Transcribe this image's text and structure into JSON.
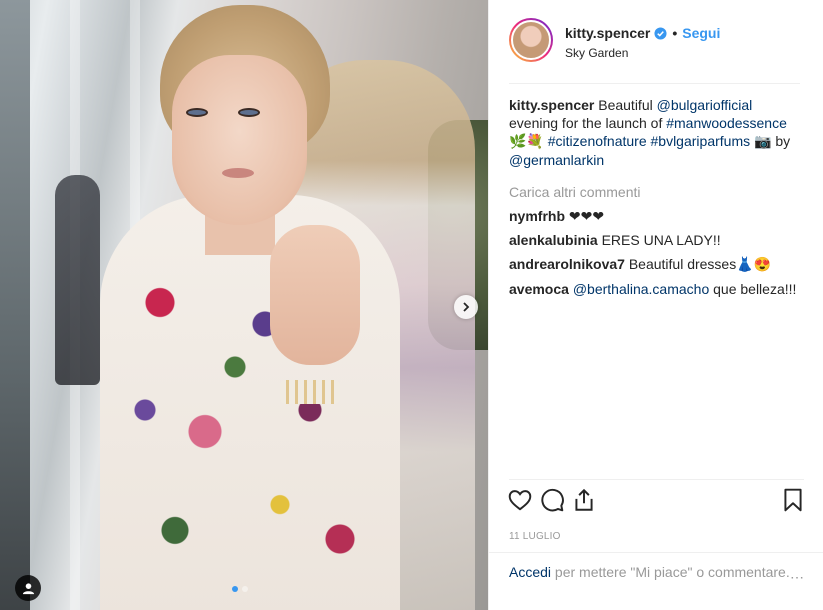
{
  "header": {
    "username": "kitty.spencer",
    "follow_label": "Segui",
    "separator": "•",
    "location": "Sky Garden"
  },
  "caption": {
    "username": "kitty.spencer",
    "text_before": "Beautiful",
    "mention1": "@bulgariofficial",
    "text_middle": "evening for the launch of",
    "hashtag1": "#manwoodessence",
    "emoji1": "🌿💐",
    "hashtag2": "#citizenofnature",
    "hashtag3": "#bvlgariparfums",
    "emoji2": "📷",
    "text_by": "by",
    "mention2": "@germanlarkin"
  },
  "load_more_label": "Carica altri commenti",
  "comments": [
    {
      "username": "nymfrhb",
      "text": "❤❤❤"
    },
    {
      "username": "alenkalubinia",
      "text": "ERES UNA LADY!!"
    },
    {
      "username": "andrearolnikova7",
      "text": "Beautiful dresses👗😍"
    },
    {
      "username": "avemoca",
      "mention": "@berthalina.camacho",
      "text": "que belleza!!!"
    }
  ],
  "actions": {
    "like_icon": "heart-icon",
    "comment_icon": "comment-icon",
    "share_icon": "share-icon",
    "save_icon": "bookmark-icon"
  },
  "date": "11 LUGLIO",
  "footer": {
    "login_label": "Accedi",
    "rest": "per mettere \"Mi piace\" o commentare.",
    "more_label": "⋯"
  },
  "carousel": {
    "slides": 2,
    "active_index": 0
  },
  "colors": {
    "accent": "#3897f0",
    "link": "#003569",
    "muted": "#999999"
  }
}
